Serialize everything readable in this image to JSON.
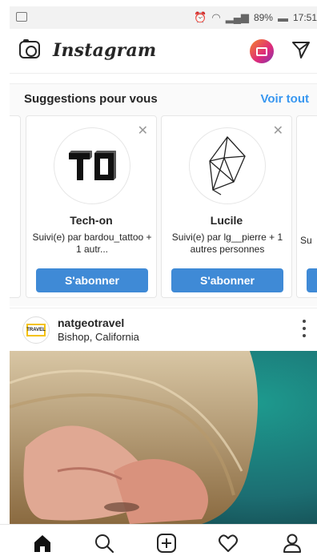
{
  "status": {
    "battery": "89%",
    "time": "17:51"
  },
  "header": {
    "app_name": "Instagram"
  },
  "suggestions": {
    "title": "Suggestions pour vous",
    "see_all": "Voir tout",
    "cards": [
      {
        "name": "Tech-on",
        "followed_by": "Suivi(e) par bardou_tattoo + 1 autr...",
        "button": "S'abonner",
        "close": "✕"
      },
      {
        "name": "Lucile",
        "followed_by": "Suivi(e) par lg__pierre + 1 autres personnes",
        "button": "S'abonner",
        "close": "✕"
      }
    ],
    "partial_card_text": "Su"
  },
  "post": {
    "username": "natgeotravel",
    "location": "Bishop, California",
    "avatar_text": "TRAVEL"
  },
  "bottom_nav": [
    "home-icon",
    "search-icon",
    "add-icon",
    "heart-icon",
    "profile-icon"
  ],
  "colors": {
    "follow_button": "#3f8ad6",
    "link_blue": "#3897f0"
  }
}
